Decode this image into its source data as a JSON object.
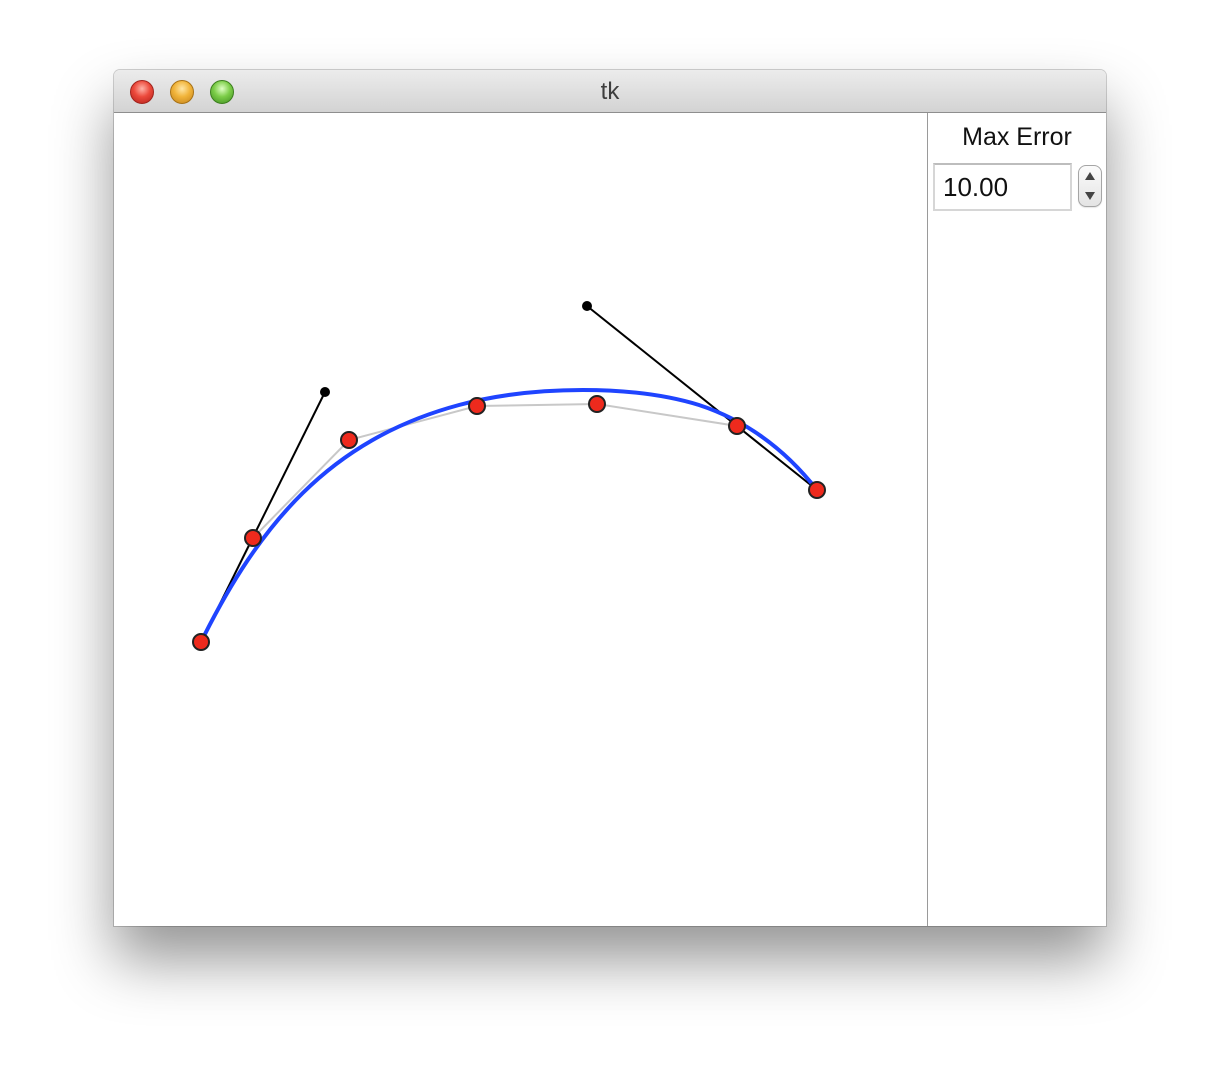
{
  "window": {
    "title": "tk"
  },
  "side_panel": {
    "label": "Max Error",
    "max_error_value": "10.00"
  },
  "colors": {
    "fitted_curve": "#1f44ff",
    "control_point_fill": "#ee2a1d",
    "polyline": "#c8c8c8",
    "tangent": "#000000"
  }
}
